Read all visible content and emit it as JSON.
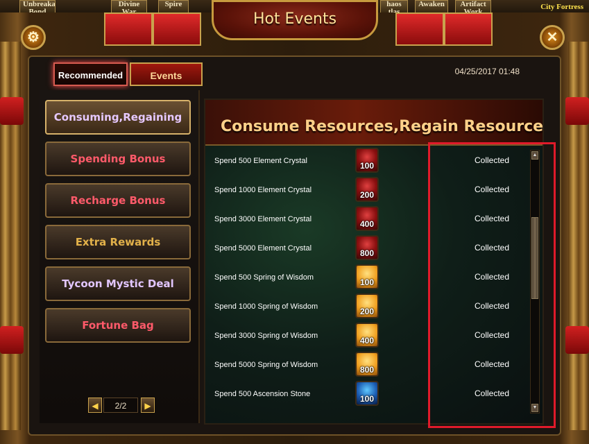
{
  "top_tabs": [
    "Unbreaka Bond",
    "Divine War",
    "Spire",
    "haos tlas",
    "Awaken",
    "Artifact Work"
  ],
  "city_label": "City Fortress",
  "window": {
    "title": "Hot Events"
  },
  "tabs": [
    {
      "label": "Recommended",
      "active": true
    },
    {
      "label": "Events",
      "active": false
    }
  ],
  "datetime": "04/25/2017 01:48",
  "sidebar": {
    "items": [
      {
        "label": "Consuming,Regaining",
        "active": true
      },
      {
        "label": "Spending Bonus"
      },
      {
        "label": "Recharge Bonus"
      },
      {
        "label": "Extra Rewards"
      },
      {
        "label": "Tycoon Mystic Deal"
      },
      {
        "label": "Fortune Bag"
      }
    ],
    "pager": {
      "current": "2/2",
      "prev_icon": "arrow-left-icon",
      "next_icon": "arrow-right-icon"
    }
  },
  "content": {
    "title": "Consume Resources,Regain Resources",
    "rows": [
      {
        "label": "Spend 500 Element Crystal",
        "reward_type": "crystal",
        "qty": "100",
        "status": "Collected"
      },
      {
        "label": "Spend 1000 Element Crystal",
        "reward_type": "crystal",
        "qty": "200",
        "status": "Collected"
      },
      {
        "label": "Spend 3000 Element Crystal",
        "reward_type": "crystal",
        "qty": "400",
        "status": "Collected"
      },
      {
        "label": "Spend 5000 Element Crystal",
        "reward_type": "crystal",
        "qty": "800",
        "status": "Collected"
      },
      {
        "label": "Spend 500 Spring of Wisdom",
        "reward_type": "wisdom",
        "qty": "100",
        "status": "Collected"
      },
      {
        "label": "Spend 1000 Spring of Wisdom",
        "reward_type": "wisdom",
        "qty": "200",
        "status": "Collected"
      },
      {
        "label": "Spend 3000 Spring of Wisdom",
        "reward_type": "wisdom",
        "qty": "400",
        "status": "Collected"
      },
      {
        "label": "Spend 5000 Spring of Wisdom",
        "reward_type": "wisdom",
        "qty": "800",
        "status": "Collected"
      },
      {
        "label": "Spend 500 Ascension Stone",
        "reward_type": "ascension",
        "qty": "100",
        "status": "Collected"
      }
    ]
  },
  "colors": {
    "highlight": "#e01a2a",
    "active_text": "#e6c8ff",
    "red_text": "#ff5a6a",
    "gold_text": "#e2b14a"
  }
}
